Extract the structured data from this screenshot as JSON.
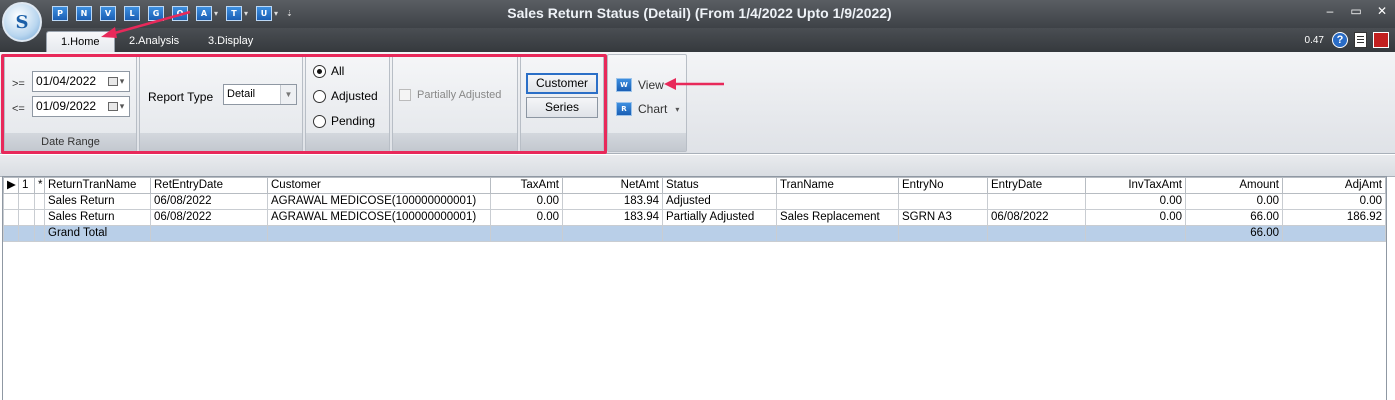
{
  "window": {
    "title": "Sales Return Status (Detail)",
    "title_range": "(From 1/4/2022 Upto 1/9/2022)",
    "logo_letter": "S",
    "controls": [
      "–",
      "▭",
      "✕"
    ]
  },
  "quick_access": [
    {
      "label": "P",
      "dropdown": false
    },
    {
      "label": "N",
      "dropdown": false
    },
    {
      "label": "V",
      "dropdown": false
    },
    {
      "label": "L",
      "dropdown": false
    },
    {
      "label": "G",
      "dropdown": false
    },
    {
      "label": "O",
      "dropdown": false
    },
    {
      "label": "A",
      "dropdown": true
    },
    {
      "label": "T",
      "dropdown": true
    },
    {
      "label": "U",
      "dropdown": true
    }
  ],
  "tabs": [
    {
      "label": "1.Home",
      "active": true
    },
    {
      "label": "2.Analysis",
      "active": false
    },
    {
      "label": "3.Display",
      "active": false
    }
  ],
  "status": {
    "zoom": "0.47",
    "help_glyph": "?"
  },
  "ribbon": {
    "date_range": {
      "label": "Date Range",
      "from_op": ">=",
      "from_value": "01/04/2022",
      "to_op": "<=",
      "to_value": "01/09/2022"
    },
    "report_type": {
      "label": "Report Type",
      "value": "Detail"
    },
    "filter_radios": [
      {
        "label": "All",
        "selected": true
      },
      {
        "label": "Adjusted",
        "selected": false
      },
      {
        "label": "Pending",
        "selected": false
      }
    ],
    "partially_adjusted": {
      "label": "Partially Adjusted",
      "checked": false,
      "enabled": false
    },
    "group_buttons": {
      "customer": "Customer",
      "series": "Series"
    },
    "actions": {
      "view": "View",
      "view_icon": "W",
      "chart": "Chart",
      "chart_icon": "R"
    }
  },
  "grid": {
    "columns": [
      "1",
      "*",
      "ReturnTranName",
      "RetEntryDate",
      "Customer",
      "TaxAmt",
      "NetAmt",
      "Status",
      "TranName",
      "EntryNo",
      "EntryDate",
      "InvTaxAmt",
      "Amount",
      "AdjAmt"
    ],
    "rows": [
      [
        "",
        "",
        "Sales Return",
        "06/08/2022",
        "AGRAWAL MEDICOSE(100000000001)",
        "0.00",
        "183.94",
        "Adjusted",
        "",
        "",
        "",
        "0.00",
        "0.00",
        "0.00"
      ],
      [
        "",
        "",
        "Sales Return",
        "06/08/2022",
        "AGRAWAL MEDICOSE(100000000001)",
        "0.00",
        "183.94",
        "Partially Adjusted",
        "Sales Replacement",
        "SGRN A3",
        "06/08/2022",
        "0.00",
        "66.00",
        "186.92"
      ]
    ],
    "total_row": [
      "",
      "",
      "Grand Total",
      "",
      "",
      "",
      "",
      "",
      "",
      "",
      "",
      "",
      "66.00",
      ""
    ]
  },
  "colors": {
    "highlight": "#e8295a",
    "accent": "#1a5fb4",
    "total_row": "#b9cfe8"
  }
}
